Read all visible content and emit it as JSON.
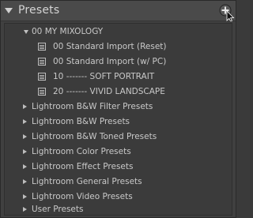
{
  "panel": {
    "title": "Presets"
  },
  "tree": {
    "expanded_folder": {
      "label": "00 MY MIXOLOGY",
      "presets": [
        {
          "label": "00 Standard Import (Reset)"
        },
        {
          "label": "00 Standard Import (w/ PC)"
        },
        {
          "label": "10 ------- SOFT PORTRAIT"
        },
        {
          "label": "20 ------- VIVID LANDSCAPE"
        }
      ]
    },
    "collapsed_folders": [
      {
        "label": "Lightroom B&W Filter Presets"
      },
      {
        "label": "Lightroom B&W Presets"
      },
      {
        "label": "Lightroom B&W Toned Presets"
      },
      {
        "label": "Lightroom Color Presets"
      },
      {
        "label": "Lightroom Effect Presets"
      },
      {
        "label": "Lightroom General Presets"
      },
      {
        "label": "Lightroom Video Presets"
      },
      {
        "label": "User Presets"
      }
    ]
  },
  "icons": {
    "collapse_panel": "triangle-down-icon",
    "add": "plus-icon",
    "cursor": "mouse-pointer-icon",
    "preset": "preset-list-icon",
    "folder_expanded": "disclosure-down-icon",
    "folder_collapsed": "disclosure-right-icon"
  },
  "colors": {
    "panel_bg": "#404040",
    "header_bg": "#4a4a4a",
    "list_bg": "#3b3b3b",
    "text": "#c9c9c9"
  }
}
